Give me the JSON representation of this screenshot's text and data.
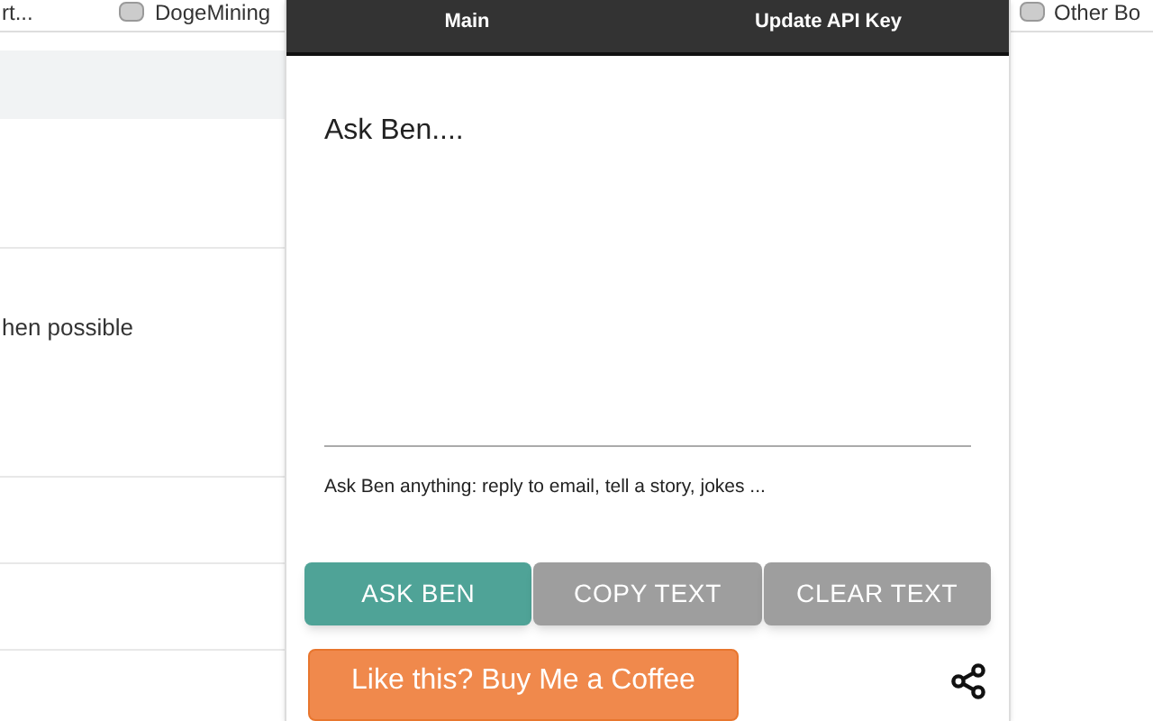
{
  "bookmarks_bar": {
    "items": [
      "rt...",
      "DogeMining"
    ],
    "right_item": "Other Bo"
  },
  "background_page": {
    "text": "hen possible"
  },
  "popup": {
    "tabs": [
      {
        "label": "Main"
      },
      {
        "label": "Update API Key"
      }
    ],
    "prompt": {
      "placeholder": "Ask Ben....",
      "helper": "Ask Ben anything: reply to email, tell a story, jokes ..."
    },
    "buttons": [
      {
        "label": "ASK BEN",
        "kind": "primary"
      },
      {
        "label": "COPY TEXT",
        "kind": "secondary"
      },
      {
        "label": "CLEAR TEXT",
        "kind": "secondary"
      }
    ],
    "coffee_button": "Like this? Buy Me a Coffee"
  }
}
